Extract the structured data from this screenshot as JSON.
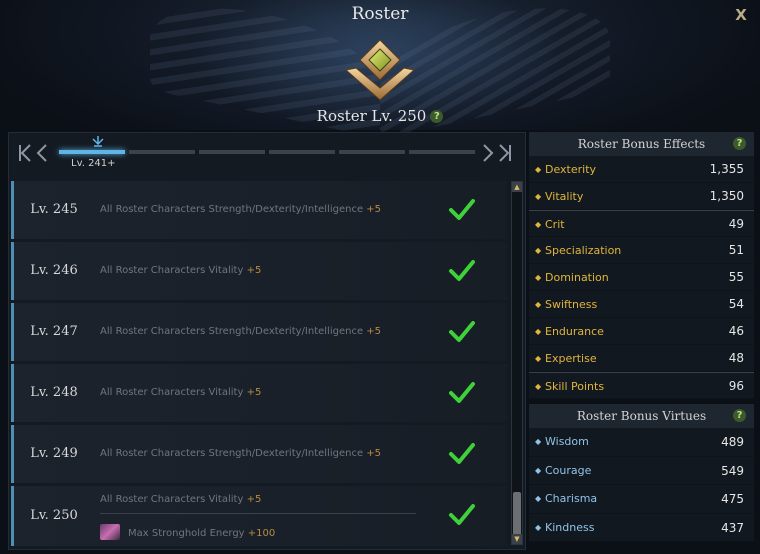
{
  "window": {
    "title": "Roster",
    "close_label": "X"
  },
  "roster": {
    "level_label": "Roster Lv. 250",
    "help": "?"
  },
  "nav": {
    "first": "K",
    "prev": "<",
    "next": ">",
    "last": "K",
    "current_segment_label": "Lv. 241+",
    "segments": 6,
    "active_segment": 1
  },
  "rows": [
    {
      "level": "Lv. 245",
      "desc": "All Roster Characters Strength/Dexterity/Intelligence",
      "bonus": "+5",
      "completed": true
    },
    {
      "level": "Lv. 246",
      "desc": "All Roster Characters Vitality",
      "bonus": "+5",
      "completed": true
    },
    {
      "level": "Lv. 247",
      "desc": "All Roster Characters Strength/Dexterity/Intelligence",
      "bonus": "+5",
      "completed": true
    },
    {
      "level": "Lv. 248",
      "desc": "All Roster Characters Vitality",
      "bonus": "+5",
      "completed": true
    },
    {
      "level": "Lv. 249",
      "desc": "All Roster Characters Strength/Dexterity/Intelligence",
      "bonus": "+5",
      "completed": true
    },
    {
      "level": "Lv. 250",
      "desc": "All Roster Characters Vitality",
      "bonus": "+5",
      "extra_desc": "Max Stronghold Energy",
      "extra_bonus": "+100",
      "completed": true
    }
  ],
  "bonus_effects": {
    "title": "Roster Bonus Effects",
    "help": "?",
    "items": [
      {
        "name": "Dexterity",
        "value": "1,355"
      },
      {
        "name": "Vitality",
        "value": "1,350"
      },
      {
        "name": "Crit",
        "value": "49"
      },
      {
        "name": "Specialization",
        "value": "51"
      },
      {
        "name": "Domination",
        "value": "55"
      },
      {
        "name": "Swiftness",
        "value": "54"
      },
      {
        "name": "Endurance",
        "value": "46"
      },
      {
        "name": "Expertise",
        "value": "48"
      },
      {
        "name": "Skill Points",
        "value": "96"
      }
    ]
  },
  "bonus_virtues": {
    "title": "Roster Bonus Virtues",
    "help": "?",
    "items": [
      {
        "name": "Wisdom",
        "value": "489"
      },
      {
        "name": "Courage",
        "value": "549"
      },
      {
        "name": "Charisma",
        "value": "475"
      },
      {
        "name": "Kindness",
        "value": "437"
      }
    ]
  },
  "colors": {
    "accent_blue": "#5fb6e6",
    "bonus_gold": "#e0b53c",
    "virtue_blue": "#8fc3e8",
    "check_green": "#3fd13a"
  },
  "icons": {
    "close": "close-icon",
    "emblem": "roster-emblem-icon",
    "check": "check-icon",
    "stronghold": "stronghold-energy-icon"
  }
}
